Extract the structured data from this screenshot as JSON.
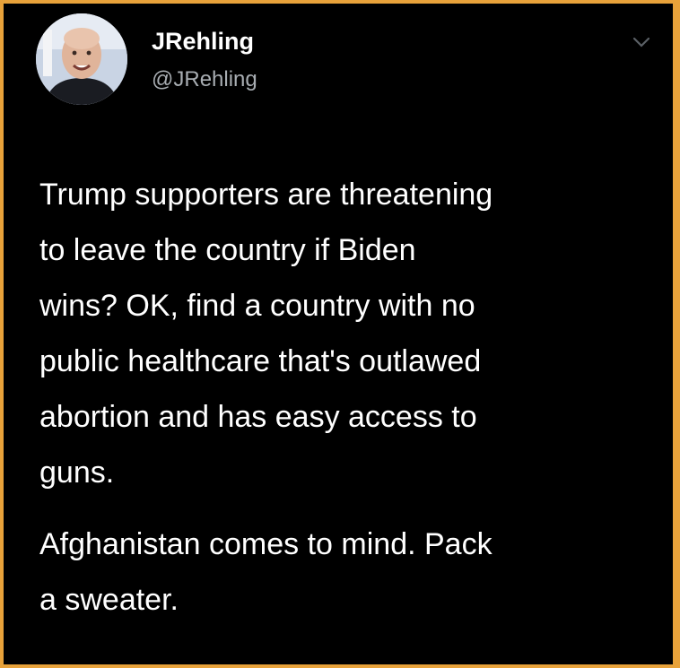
{
  "author": {
    "display_name": "JRehling",
    "handle": "@JRehling",
    "avatar_icon": "profile-photo"
  },
  "menu": {
    "icon": "chevron-down-icon"
  },
  "tweet": {
    "paragraphs": [
      "Trump supporters are threatening\nto leave the country if Biden\nwins? OK, find a country with no\npublic healthcare that's outlawed\nabortion and has easy access to\nguns.",
      "Afghanistan comes to mind. Pack\na sweater."
    ]
  },
  "colors": {
    "background": "#000000",
    "border": "#e8a23a",
    "text": "#ffffff",
    "handle": "#a8adb2"
  }
}
